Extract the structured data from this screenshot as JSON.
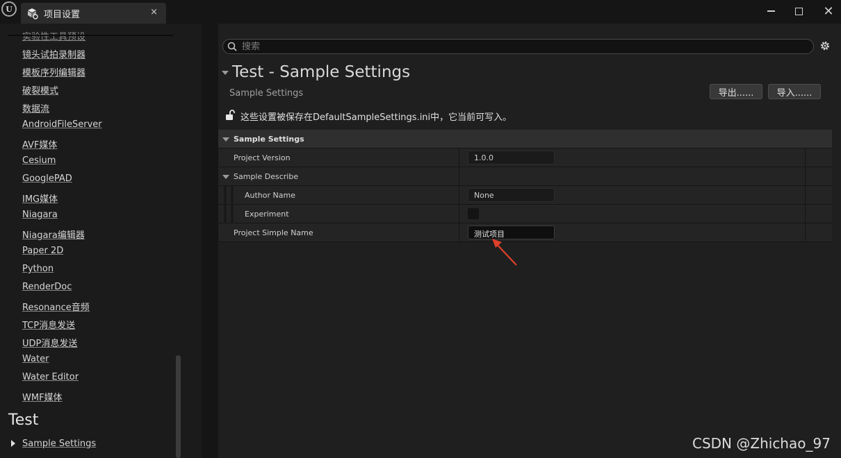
{
  "window": {
    "tab_title": "项目设置",
    "tab_close": "×",
    "close_glyph": "✕"
  },
  "sidebar": {
    "cut_item": "实验性工具预设",
    "items": [
      "镜头试拍录制器",
      "模板序列编辑器",
      "破裂模式",
      "数据流",
      "AndroidFileServer",
      "AVF媒体",
      "Cesium",
      "GooglePAD",
      "IMG媒体",
      "Niagara",
      "Niagara编辑器",
      "Paper 2D",
      "Python",
      "RenderDoc",
      "Resonance音频",
      "TCP消息发送",
      "UDP消息发送",
      "Water",
      "Water Editor",
      "WMF媒体"
    ],
    "section_title": "Test",
    "section_items": [
      "Sample Settings"
    ]
  },
  "search": {
    "placeholder": "搜索",
    "value": ""
  },
  "header": {
    "title": "Test - Sample Settings",
    "subtitle": "Sample Settings",
    "export_label": "导出......",
    "import_label": "导入......",
    "config_note": "这些设置被保存在DefaultSampleSettings.ini中，它当前可写入。"
  },
  "properties": {
    "category": "Sample Settings",
    "project_version_label": "Project Version",
    "project_version_value": "1.0.0",
    "sample_describe_label": "Sample Describe",
    "author_name_label": "Author Name",
    "author_name_value": "None",
    "experiment_label": "Experiment",
    "experiment_checked": false,
    "project_simple_name_label": "Project Simple Name",
    "project_simple_name_value": "测试项目"
  },
  "annotation": {
    "arrow_color": "#e0402a"
  },
  "watermark": "CSDN @Zhichao_97",
  "icons": {
    "logo": "unreal-logo-icon",
    "tab": "project-settings-icon",
    "search": "search-icon",
    "settings": "gear-icon",
    "lock": "unlocked-icon"
  }
}
